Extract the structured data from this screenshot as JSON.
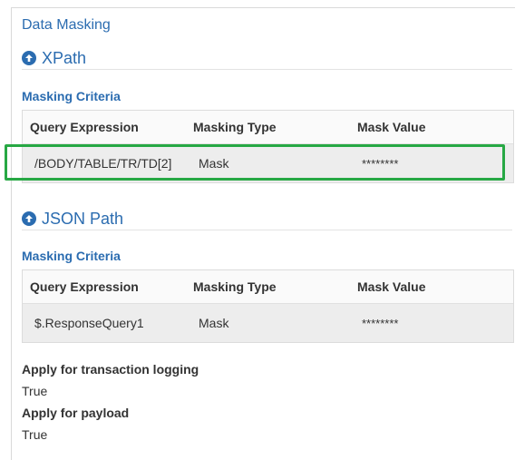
{
  "panel": {
    "title": "Data Masking"
  },
  "xpath": {
    "heading": "XPath",
    "criteria_label": "Masking Criteria",
    "columns": [
      "Query Expression",
      "Masking Type",
      "Mask Value"
    ],
    "rows": [
      {
        "expression": "/BODY/TABLE/TR/TD[2]",
        "type": "Mask",
        "value": "********"
      }
    ]
  },
  "json_path": {
    "heading": "JSON Path",
    "criteria_label": "Masking Criteria",
    "columns": [
      "Query Expression",
      "Masking Type",
      "Mask Value"
    ],
    "rows": [
      {
        "expression": "$.ResponseQuery1",
        "type": "Mask",
        "value": "********"
      }
    ]
  },
  "settings": {
    "transaction_logging_label": "Apply for transaction logging",
    "transaction_logging_value": "True",
    "payload_label": "Apply for payload",
    "payload_value": "True"
  },
  "colors": {
    "accent": "#2b6cb0",
    "highlight": "#27a844",
    "row_bg": "#ededed"
  },
  "icons": {
    "section_toggle": "circle-arrow-up-icon"
  }
}
